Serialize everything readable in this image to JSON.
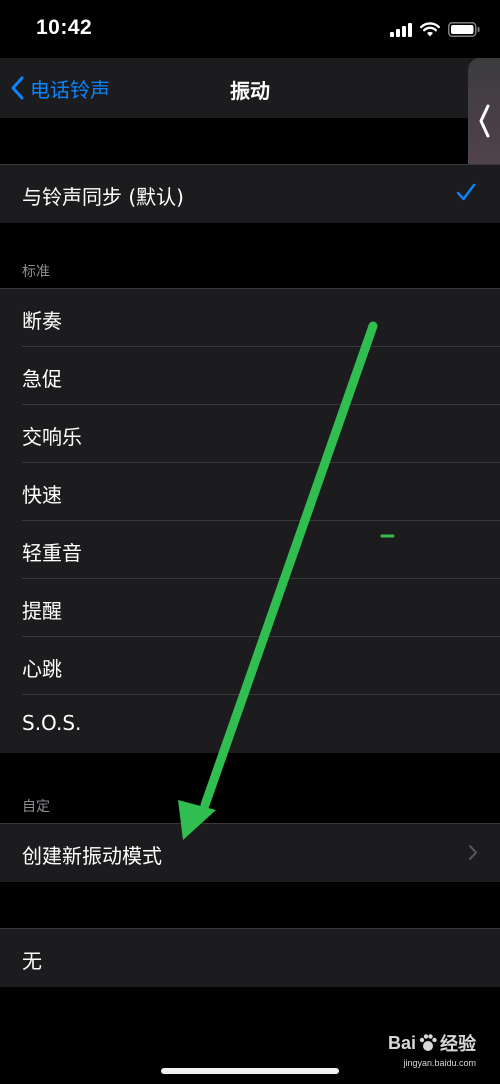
{
  "status_bar": {
    "time": "10:42"
  },
  "nav": {
    "back_label": "电话铃声",
    "title": "振动"
  },
  "sync_cell": {
    "label": "与铃声同步 (默认)",
    "checked": true
  },
  "standard_section": {
    "header": "标准",
    "items": [
      {
        "label": "断奏"
      },
      {
        "label": "急促"
      },
      {
        "label": "交响乐"
      },
      {
        "label": "快速"
      },
      {
        "label": "轻重音"
      },
      {
        "label": "提醒"
      },
      {
        "label": "心跳"
      },
      {
        "label": "S.O.S."
      }
    ]
  },
  "custom_section": {
    "header": "自定",
    "create_label": "创建新振动模式"
  },
  "none_cell": {
    "label": "无"
  },
  "watermark": {
    "logo_text": "Bai",
    "logo_suffix": "经验",
    "site": "jingyan.baidu.com"
  },
  "colors": {
    "accent": "#0a84ff",
    "arrow": "#2fbe4f",
    "cell_bg": "#1c1c1e",
    "background": "#000000"
  },
  "icons": {
    "back": "chevron-left-icon",
    "check": "checkmark-icon",
    "disclosure": "chevron-right-icon",
    "signal": "cellular-signal-icon",
    "wifi": "wifi-icon",
    "battery": "battery-icon"
  }
}
